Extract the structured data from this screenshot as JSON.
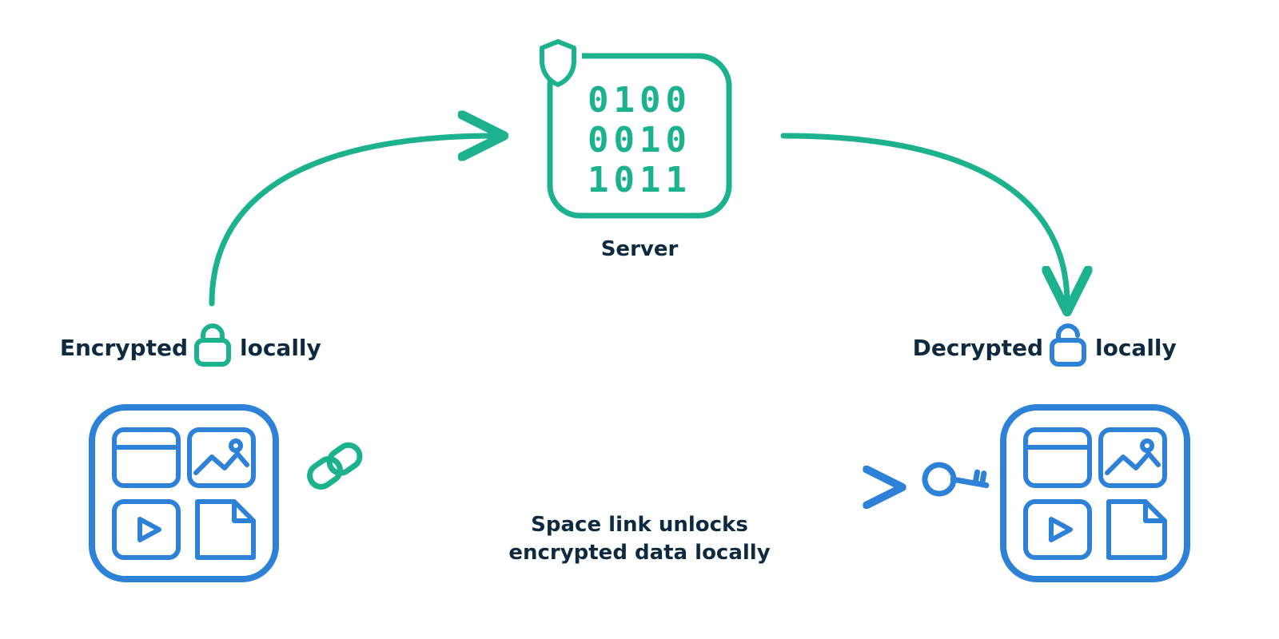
{
  "colors": {
    "teal": "#1db28e",
    "blue": "#2d82d8",
    "ink": "#0f2a3f"
  },
  "server": {
    "label": "Server",
    "binary": [
      "0100",
      "0010",
      "1011"
    ]
  },
  "left": {
    "prefix": "Encrypted",
    "suffix": "locally"
  },
  "right": {
    "prefix": "Decrypted",
    "suffix": "locally"
  },
  "link": {
    "line1": "Space link unlocks",
    "line2": "encrypted data locally"
  }
}
